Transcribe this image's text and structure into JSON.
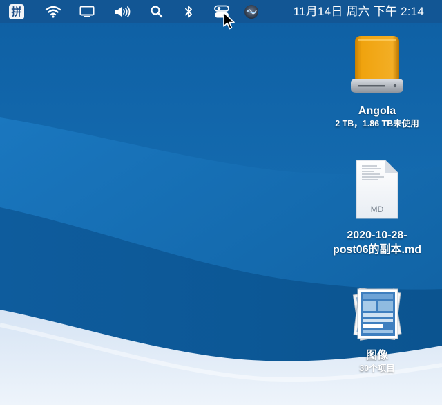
{
  "menubar": {
    "input_method_label": "拼",
    "clock_text": "11月14日 周六 下午 2:14",
    "icons": [
      "input-method-icon",
      "wifi-icon",
      "airplay-display-icon",
      "volume-icon",
      "spotlight-search-icon",
      "bluetooth-icon",
      "control-center-icon",
      "siri-icon"
    ]
  },
  "desktop": {
    "drive": {
      "name": "Angola",
      "info": "2 TB，1.86 TB未使用"
    },
    "file": {
      "type_badge": "MD",
      "name_line1": "2020-10-28-",
      "name_line2": "post06的副本.md"
    },
    "stack": {
      "name": "图像",
      "info": "30个项目"
    }
  },
  "colors": {
    "wallpaper_blue": "#1266a8",
    "drive_orange": "#f0a30e",
    "menubar_text": "#ffffff"
  }
}
